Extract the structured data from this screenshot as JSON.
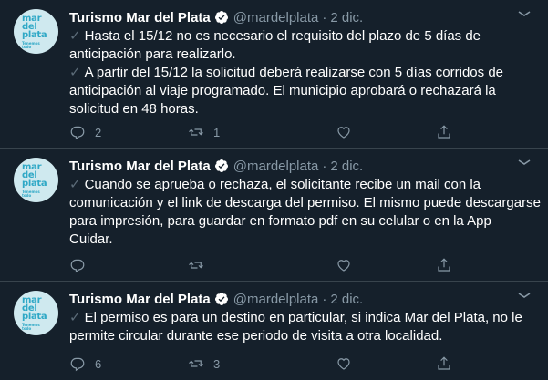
{
  "tweets": [
    {
      "name": "Turismo Mar del Plata",
      "handle": "@mardelplata",
      "separator": "·",
      "date": "2 dic.",
      "lines": [
        "✓ Hasta el 15/12 no es necesario el requisito del plazo de 5 días de",
        "anticipación para realizarlo.",
        "✓ A partir del 15/12 la solicitud deberá realizarse con 5 días corridos de",
        "anticipación al viaje programado. El municipio aprobará o rechazará la",
        "solicitud en 48 horas."
      ],
      "reply_count": "2",
      "retweet_count": "1",
      "like_count": ""
    },
    {
      "name": "Turismo Mar del Plata",
      "handle": "@mardelplata",
      "separator": "·",
      "date": "2 dic.",
      "lines": [
        "✓ Cuando se aprueba o rechaza, el solicitante recibe un mail con la",
        "comunicación y el link de descarga del permiso. El mismo puede descargarse",
        "para impresión, para guardar en formato pdf en su celular o en la App",
        "Cuidar."
      ],
      "reply_count": "",
      "retweet_count": "",
      "like_count": ""
    },
    {
      "name": "Turismo Mar del Plata",
      "handle": "@mardelplata",
      "separator": "·",
      "date": "2 dic.",
      "lines": [
        "✓ El permiso es para un destino en particular, si indica Mar del Plata, no le",
        "permite circular durante ese periodo de visita a otra localidad."
      ],
      "reply_count": "6",
      "retweet_count": "3",
      "like_count": ""
    }
  ],
  "avatar": {
    "logo_lines": [
      "mar",
      "del",
      "plata"
    ],
    "logo_sub": [
      "Tenemos",
      "todo"
    ]
  },
  "colors": {
    "background": "#15202b",
    "text": "#ffffff",
    "secondary": "#8899a6",
    "verified": "#ffffff",
    "check": "#5b6b78",
    "avatar_bg": "#cfe9ef",
    "logo": "#2fa8c6",
    "divider": "#38444d"
  },
  "icons": [
    "verified-badge-icon",
    "chevron-down-icon",
    "reply-icon",
    "retweet-icon",
    "like-icon",
    "share-icon"
  ]
}
